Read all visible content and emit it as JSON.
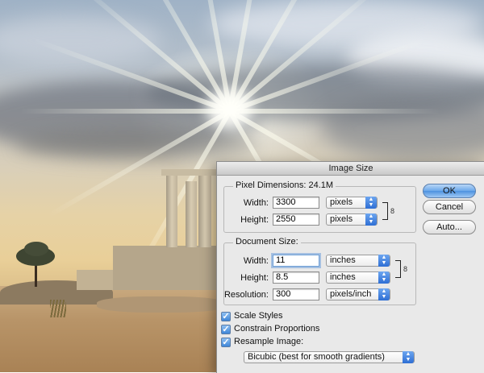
{
  "dialog": {
    "title": "Image Size",
    "pixel_dimensions": {
      "label": "Pixel Dimensions:",
      "size": "24.1M",
      "width_label": "Width:",
      "width_value": "3300",
      "width_unit": "pixels",
      "height_label": "Height:",
      "height_value": "2550",
      "height_unit": "pixels"
    },
    "document_size": {
      "label": "Document Size:",
      "width_label": "Width:",
      "width_value": "11",
      "width_unit": "inches",
      "height_label": "Height:",
      "height_value": "8.5",
      "height_unit": "inches",
      "resolution_label": "Resolution:",
      "resolution_value": "300",
      "resolution_unit": "pixels/inch"
    },
    "options": {
      "scale_styles": {
        "label": "Scale Styles",
        "checked": true
      },
      "constrain_proportions": {
        "label": "Constrain Proportions",
        "checked": true
      },
      "resample_image": {
        "label": "Resample Image:",
        "checked": true
      },
      "resample_method": "Bicubic (best for smooth gradients)"
    },
    "buttons": {
      "ok": "OK",
      "cancel": "Cancel",
      "auto": "Auto..."
    }
  },
  "icons": [
    "chain-link-icon",
    "popup-arrows-icon",
    "checkmark-icon"
  ],
  "colors": {
    "default_button": "#6aa7ea",
    "popup_arrows": "#2e6ed4",
    "dialog_bg": "#e9e9e9"
  }
}
